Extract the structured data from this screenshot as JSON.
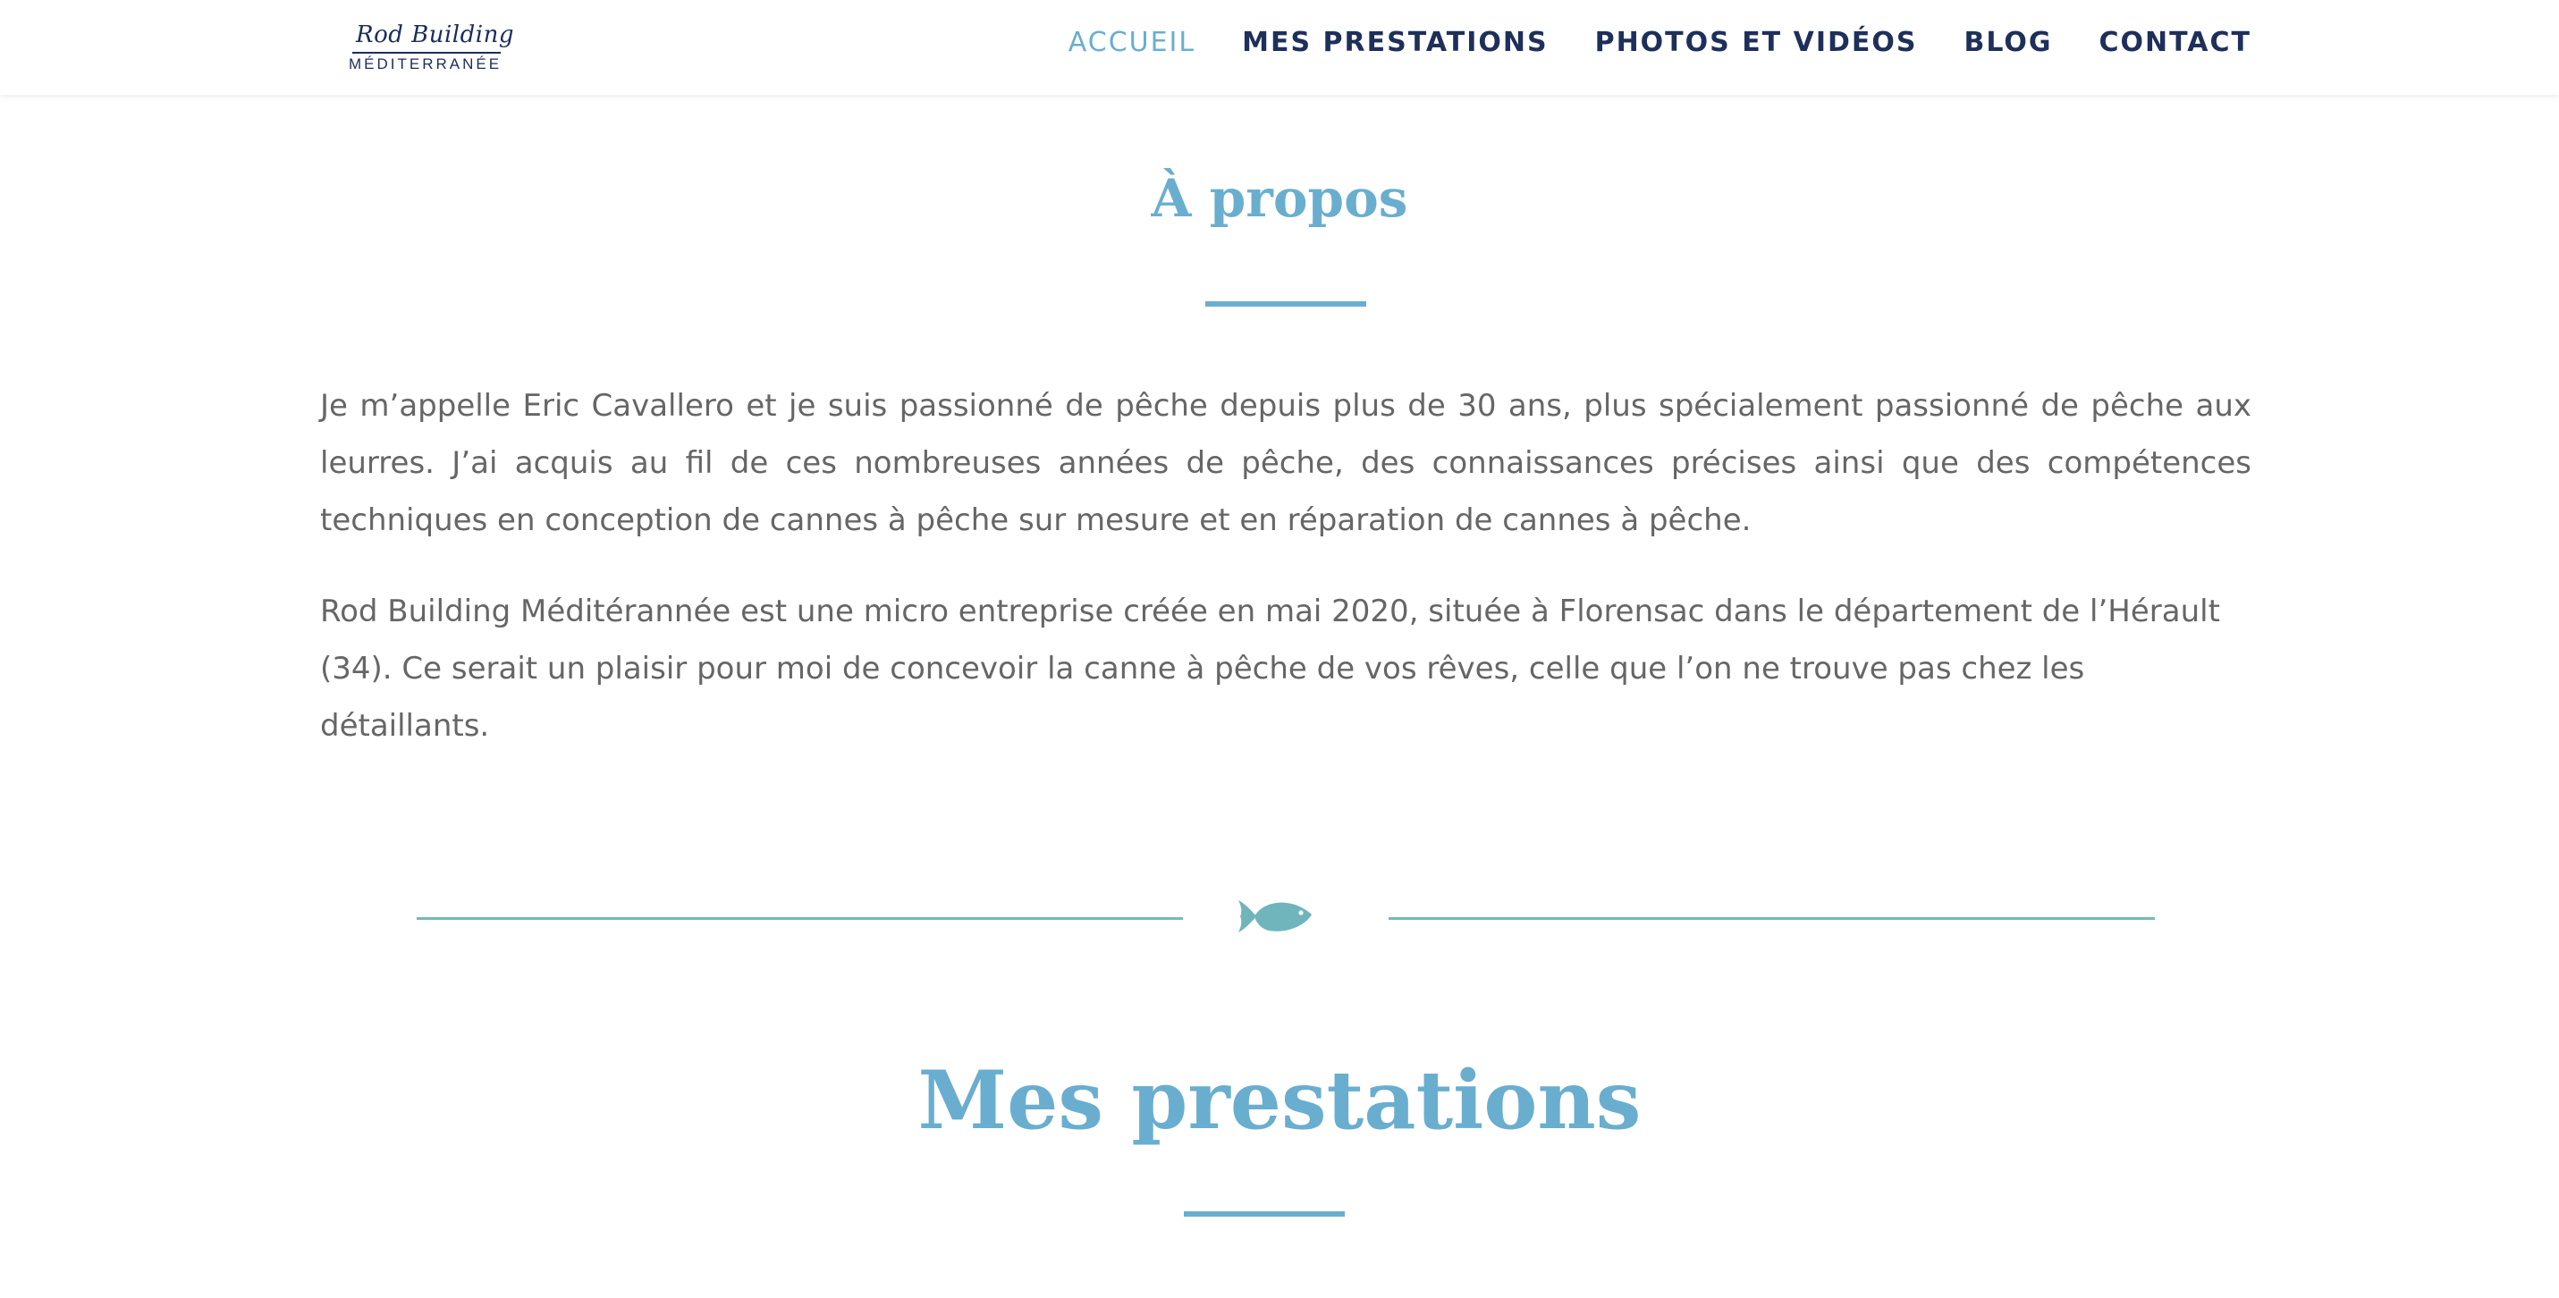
{
  "header": {
    "logo": {
      "script": "Rod Building",
      "sub": "MÉDITERRANÉE"
    },
    "nav": [
      {
        "label": "ACCUEIL",
        "active": true
      },
      {
        "label": "MES PRESTATIONS",
        "active": false
      },
      {
        "label": "PHOTOS ET VIDÉOS",
        "active": false
      },
      {
        "label": "BLOG",
        "active": false
      },
      {
        "label": "CONTACT",
        "active": false
      }
    ]
  },
  "about": {
    "title": "À propos",
    "paragraphs": [
      "Je m’appelle Eric Cavallero et je suis passionné de pêche depuis plus de 30 ans, plus spécialement passionné de pêche aux leurres. J’ai acquis au fil de ces nombreuses années de pêche, des connaissances précises ainsi que des compétences techniques en conception de cannes à pêche sur mesure et en réparation de cannes à pêche.",
      "Rod Building Méditérannée est une micro entreprise créée en mai 2020, située à Florensac dans le département de l’Hérault (34). Ce serait un plaisir pour moi de concevoir la canne à pêche de vos rêves, celle que l’on ne trouve pas chez les détaillants."
    ]
  },
  "divider": {
    "icon": "fish-icon"
  },
  "services": {
    "title": "Mes prestations"
  },
  "colors": {
    "accent": "#6aaecf",
    "nav_text": "#1e2f5a",
    "body_text": "#666666",
    "divider": "#74b8bc"
  }
}
